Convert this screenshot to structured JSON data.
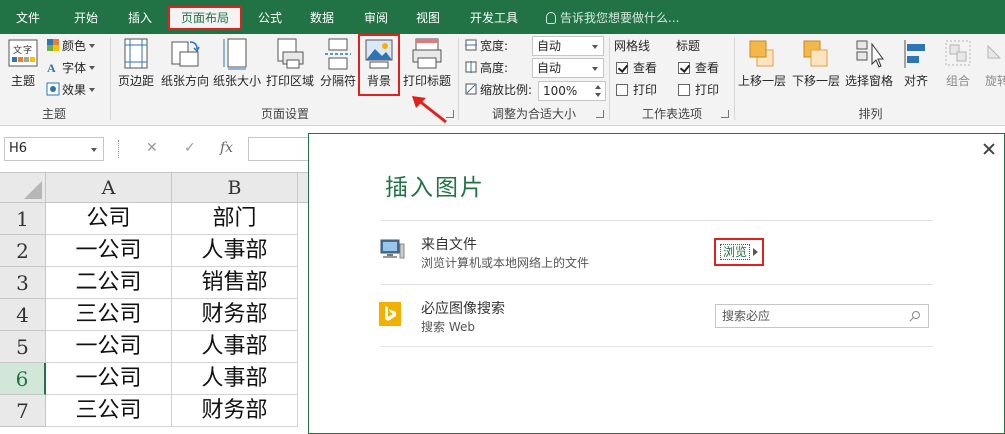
{
  "tabs": [
    {
      "label": "文件",
      "active": false
    },
    {
      "label": "开始",
      "active": false
    },
    {
      "label": "插入",
      "active": false
    },
    {
      "label": "页面布局",
      "active": true
    },
    {
      "label": "公式",
      "active": false
    },
    {
      "label": "数据",
      "active": false
    },
    {
      "label": "审阅",
      "active": false
    },
    {
      "label": "视图",
      "active": false
    },
    {
      "label": "开发工具",
      "active": false
    }
  ],
  "tell_me": "告诉我您想要做什么...",
  "ribbon": {
    "theme_group": {
      "label": "主题",
      "theme_button": "主题",
      "colors": "颜色",
      "fonts": "字体",
      "effects": "效果"
    },
    "page_setup_group": {
      "label": "页面设置",
      "margins": "页边距",
      "orientation": "纸张方向",
      "size": "纸张大小",
      "print_area": "打印区域",
      "breaks": "分隔符",
      "background": "背景",
      "print_titles": "打印标题"
    },
    "scale_group": {
      "label": "调整为合适大小",
      "width_label": "宽度:",
      "width_value": "自动",
      "height_label": "高度:",
      "height_value": "自动",
      "scale_label": "缩放比例:",
      "scale_value": "100%"
    },
    "sheet_options_group": {
      "label": "工作表选项",
      "gridlines": "网格线",
      "headings": "标题",
      "view": "查看",
      "print": "打印"
    },
    "arrange_group": {
      "label": "排列",
      "bring_forward": "上移一层",
      "send_backward": "下移一层",
      "selection_pane": "选择窗格",
      "align": "对齐",
      "group": "组合",
      "rotate": "旋转"
    }
  },
  "formula_bar": {
    "name_box": "H6",
    "cancel": "✕",
    "enter": "✓",
    "fx": "fx"
  },
  "sheet": {
    "columns": [
      "A",
      "B"
    ],
    "rows": [
      {
        "num": "1",
        "a": "公司",
        "b": "部门"
      },
      {
        "num": "2",
        "a": "一公司",
        "b": "人事部"
      },
      {
        "num": "3",
        "a": "二公司",
        "b": "销售部"
      },
      {
        "num": "4",
        "a": "三公司",
        "b": "财务部"
      },
      {
        "num": "5",
        "a": "一公司",
        "b": "人事部"
      },
      {
        "num": "6",
        "a": "一公司",
        "b": "人事部"
      },
      {
        "num": "7",
        "a": "三公司",
        "b": "财务部"
      }
    ]
  },
  "dialog": {
    "title": "插入图片",
    "from_file": {
      "title": "来自文件",
      "subtitle": "浏览计算机或本地网络上的文件",
      "action": "浏览"
    },
    "bing": {
      "title": "必应图像搜索",
      "subtitle": "搜索 Web",
      "placeholder": "搜索必应"
    }
  },
  "colors": {
    "excel_green": "#217346",
    "highlight_red": "#e0221f",
    "bing_yellow": "#f2b100"
  }
}
